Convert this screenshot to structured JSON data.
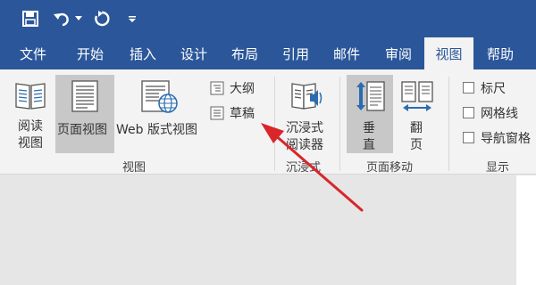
{
  "qat": {
    "icons": [
      "save-icon",
      "undo-icon",
      "undo-dropdown-icon",
      "redo-icon",
      "customize-qat-icon"
    ]
  },
  "tabs": [
    {
      "label": "文件"
    },
    {
      "label": "开始"
    },
    {
      "label": "插入"
    },
    {
      "label": "设计"
    },
    {
      "label": "布局"
    },
    {
      "label": "引用"
    },
    {
      "label": "邮件"
    },
    {
      "label": "审阅"
    },
    {
      "label": "视图",
      "active": true
    },
    {
      "label": "帮助"
    }
  ],
  "ribbon": {
    "views": {
      "group_label": "视图",
      "read_mode": "阅读\n视图",
      "read_mode_l1": "阅读",
      "read_mode_l2": "视图",
      "print_layout": "页面视图",
      "web_layout": "Web 版式视图",
      "outline": "大纲",
      "draft": "草稿"
    },
    "immersive": {
      "group_label": "沉浸式",
      "reader_l1": "沉浸式",
      "reader_l2": "阅读器"
    },
    "page_movement": {
      "group_label": "页面移动",
      "vertical_l1": "垂",
      "vertical_l2": "直",
      "side_l1": "翻",
      "side_l2": "页"
    },
    "show": {
      "group_label": "显示",
      "ruler": "标尺",
      "gridlines": "网格线",
      "nav_pane": "导航窗格",
      "ruler_checked": false,
      "gridlines_checked": false,
      "nav_pane_checked": false
    }
  },
  "colors": {
    "title_bar": "#2b579a",
    "ribbon": "#f3f3f3",
    "selected": "#c8c8c8",
    "annotation_arrow": "#d9262b"
  }
}
